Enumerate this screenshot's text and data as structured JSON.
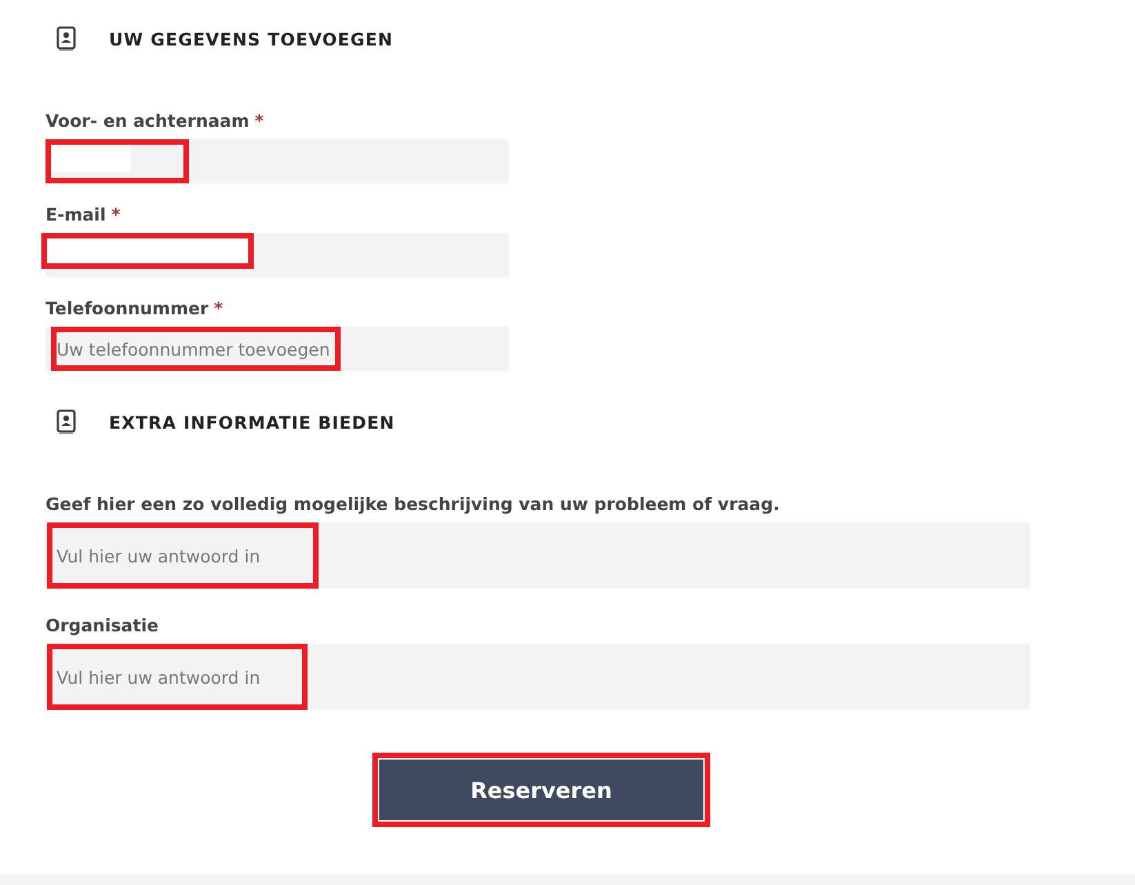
{
  "sections": [
    {
      "title": "UW GEGEVENS TOEVOEGEN",
      "fields": [
        {
          "label": "Voor- en achternaam",
          "required_mark": "*",
          "redacted": true,
          "highlighted": true
        },
        {
          "label": "E-mail",
          "required_mark": "*",
          "redacted": true,
          "highlighted": true
        },
        {
          "label": "Telefoonnummer",
          "required_mark": "*",
          "placeholder": "Uw telefoonnummer toevoegen",
          "highlighted": true
        }
      ]
    },
    {
      "title": "EXTRA INFORMATIE BIEDEN",
      "fields": [
        {
          "label": "Geef hier een zo volledig mogelijke beschrijving van uw probleem of vraag.",
          "placeholder": "Vul hier uw antwoord in",
          "highlighted": true
        },
        {
          "label": "Organisatie",
          "placeholder": "Vul hier uw antwoord in",
          "highlighted": true
        }
      ]
    }
  ],
  "submit": {
    "label": "Reserveren",
    "highlighted": true
  }
}
